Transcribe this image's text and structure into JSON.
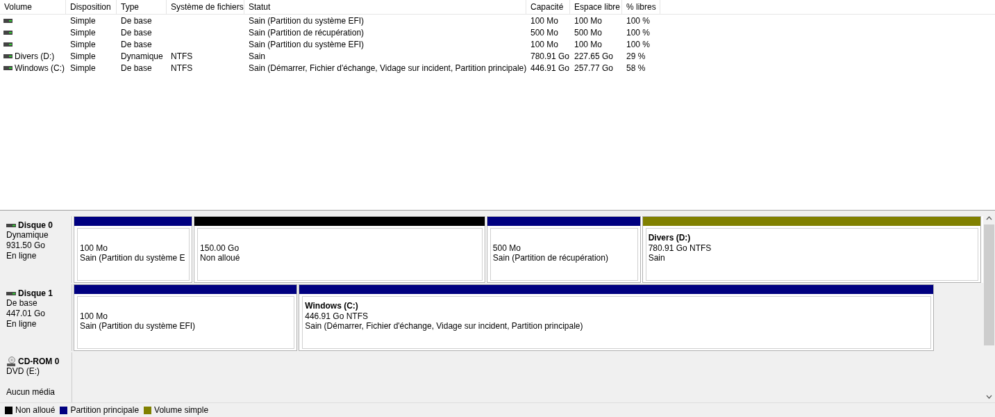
{
  "volume_table": {
    "columns": [
      "Volume",
      "Disposition",
      "Type",
      "Système de fichiers",
      "Statut",
      "Capacité",
      "Espace libre",
      "% libres"
    ],
    "rows": [
      {
        "cells": [
          "",
          "Simple",
          "De base",
          "",
          "Sain (Partition du système EFI)",
          "100 Mo",
          "100 Mo",
          "100 %"
        ]
      },
      {
        "cells": [
          "",
          "Simple",
          "De base",
          "",
          "Sain (Partition de récupération)",
          "500 Mo",
          "500 Mo",
          "100 %"
        ]
      },
      {
        "cells": [
          "",
          "Simple",
          "De base",
          "",
          "Sain (Partition du système EFI)",
          "100 Mo",
          "100 Mo",
          "100 %"
        ]
      },
      {
        "cells": [
          "Divers (D:)",
          "Simple",
          "Dynamique",
          "NTFS",
          "Sain",
          "780.91 Go",
          "227.65 Go",
          "29 %"
        ]
      },
      {
        "cells": [
          "Windows (C:)",
          "Simple",
          "De base",
          "NTFS",
          "Sain (Démarrer, Fichier d'échange, Vidage sur incident, Partition principale)",
          "446.91 Go",
          "257.77 Go",
          "58 %"
        ]
      }
    ]
  },
  "disks": [
    {
      "kind": "disk",
      "name": "Disque 0",
      "lines": [
        "Dynamique",
        "931.50 Go",
        "En ligne"
      ],
      "partitions": [
        {
          "color": "#000080",
          "size": "100 Mo",
          "status": "Sain (Partition du système E"
        },
        {
          "color": "#000000",
          "size": "150.00 Go",
          "status": "Non alloué"
        },
        {
          "color": "#000080",
          "size": "500 Mo",
          "status": "Sain (Partition de récupération)"
        },
        {
          "color": "#808000",
          "name": "Divers  (D:)",
          "size": "780.91 Go NTFS",
          "status": "Sain"
        }
      ]
    },
    {
      "kind": "disk",
      "name": "Disque 1",
      "lines": [
        "De base",
        "447.01 Go",
        "En ligne"
      ],
      "partitions": [
        {
          "color": "#000080",
          "size": "100 Mo",
          "status": "Sain (Partition du système EFI)"
        },
        {
          "color": "#000080",
          "name": "Windows  (C:)",
          "size": "446.91 Go NTFS",
          "status": "Sain (Démarrer, Fichier d'échange, Vidage sur incident, Partition principale)"
        }
      ]
    },
    {
      "kind": "cdrom",
      "name": "CD-ROM 0",
      "lines": [
        "DVD (E:)",
        "Aucun média"
      ]
    }
  ],
  "legend": [
    {
      "label": "Non alloué",
      "color": "#000000"
    },
    {
      "label": "Partition principale",
      "color": "#000080"
    },
    {
      "label": "Volume simple",
      "color": "#808000"
    }
  ]
}
